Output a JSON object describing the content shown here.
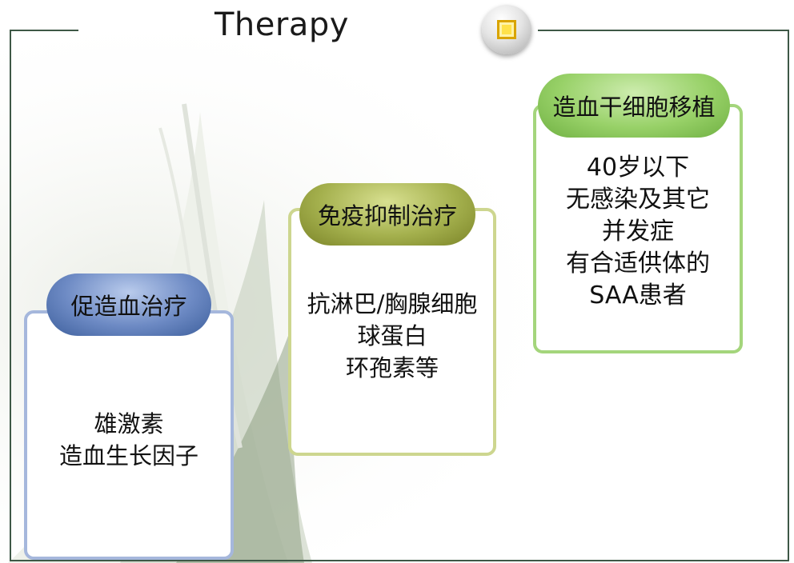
{
  "title": "Therapy",
  "colors": {
    "frame": "#3e5846",
    "blue_box": "#a5b7dc",
    "olive_box": "#cdd68f",
    "green_box": "#a4d57c",
    "badge_accent": "#ffe24a"
  },
  "boxes": [
    {
      "heading": "促造血治疗",
      "lines": [
        "雄激素",
        "造血生长因子"
      ]
    },
    {
      "heading": "免疫抑制治疗",
      "lines": [
        "抗淋巴/胸腺细胞",
        "球蛋白",
        "环孢素等"
      ]
    },
    {
      "heading": "造血干细胞移植",
      "lines": [
        "40岁以下",
        "无感染及其它",
        "并发症",
        "有合适供体的",
        "SAA患者"
      ]
    }
  ]
}
